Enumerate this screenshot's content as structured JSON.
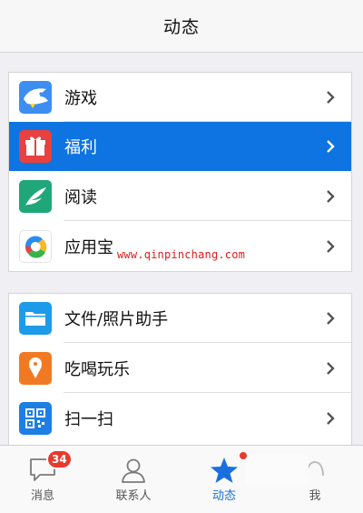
{
  "header": {
    "title": "动态"
  },
  "group1": [
    {
      "label": "游戏",
      "icon": "game-shark-icon",
      "color": "#3d8ef0"
    },
    {
      "label": "福利",
      "icon": "gift-icon",
      "color": "#e94040",
      "active": true
    },
    {
      "label": "阅读",
      "icon": "feather-icon",
      "color": "#1fa77a"
    },
    {
      "label": "应用宝",
      "icon": "app-store-icon",
      "color": "#ffffff"
    }
  ],
  "group2": [
    {
      "label": "文件/照片助手",
      "icon": "folder-icon",
      "color": "#1e9be8"
    },
    {
      "label": "吃喝玩乐",
      "icon": "ice-cream-icon",
      "color": "#f07a24"
    },
    {
      "label": "扫一扫",
      "icon": "qr-scan-icon",
      "color": "#1d7fe3"
    }
  ],
  "watermark": "www.qinpinchang.com",
  "tabs": [
    {
      "label": "消息",
      "icon": "chat-bubble-icon",
      "badge": "34"
    },
    {
      "label": "联系人",
      "icon": "contact-person-icon"
    },
    {
      "label": "动态",
      "icon": "star-icon",
      "active": true
    },
    {
      "label": "我",
      "icon": "me-icon"
    }
  ],
  "colors": {
    "accent": "#0d74e1",
    "badge": "#e8392e"
  }
}
